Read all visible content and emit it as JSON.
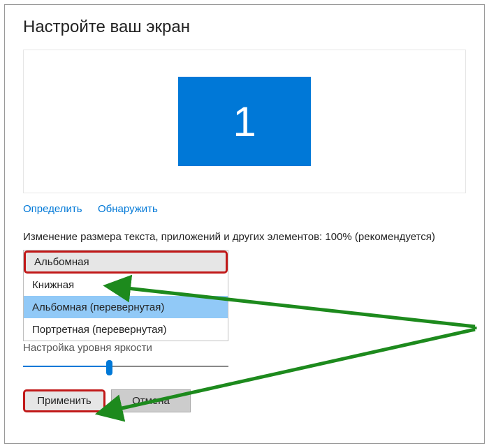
{
  "heading": "Настройте ваш экран",
  "monitor": {
    "number": "1"
  },
  "links": {
    "identify": "Определить",
    "detect": "Обнаружить"
  },
  "scale_label": "Изменение размера текста, приложений и других элементов: 100% (рекомендуется)",
  "orientation": {
    "selected": "Альбомная",
    "options": [
      "Книжная",
      "Альбомная (перевернутая)",
      "Портретная (перевернутая)"
    ],
    "hover_index": 1
  },
  "brightness": {
    "label": "Настройка уровня яркости",
    "value_pct": 42
  },
  "buttons": {
    "apply": "Применить",
    "cancel": "Отмена"
  },
  "colors": {
    "accent": "#0078d7",
    "highlight_red": "#c11919",
    "arrow_green": "#1d8a1d"
  }
}
